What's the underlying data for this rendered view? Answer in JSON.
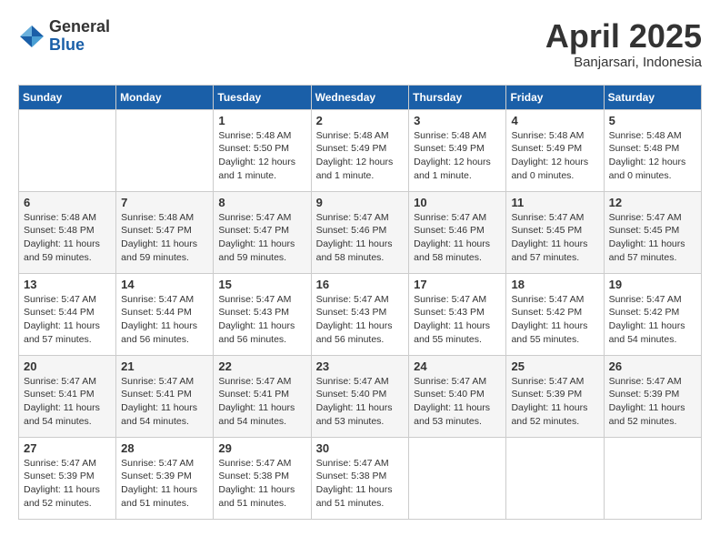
{
  "header": {
    "logo_general": "General",
    "logo_blue": "Blue",
    "title": "April 2025",
    "location": "Banjarsari, Indonesia"
  },
  "days_of_week": [
    "Sunday",
    "Monday",
    "Tuesday",
    "Wednesday",
    "Thursday",
    "Friday",
    "Saturday"
  ],
  "weeks": [
    [
      {
        "day": "",
        "info": ""
      },
      {
        "day": "",
        "info": ""
      },
      {
        "day": "1",
        "info": "Sunrise: 5:48 AM\nSunset: 5:50 PM\nDaylight: 12 hours\nand 1 minute."
      },
      {
        "day": "2",
        "info": "Sunrise: 5:48 AM\nSunset: 5:49 PM\nDaylight: 12 hours\nand 1 minute."
      },
      {
        "day": "3",
        "info": "Sunrise: 5:48 AM\nSunset: 5:49 PM\nDaylight: 12 hours\nand 1 minute."
      },
      {
        "day": "4",
        "info": "Sunrise: 5:48 AM\nSunset: 5:49 PM\nDaylight: 12 hours\nand 0 minutes."
      },
      {
        "day": "5",
        "info": "Sunrise: 5:48 AM\nSunset: 5:48 PM\nDaylight: 12 hours\nand 0 minutes."
      }
    ],
    [
      {
        "day": "6",
        "info": "Sunrise: 5:48 AM\nSunset: 5:48 PM\nDaylight: 11 hours\nand 59 minutes."
      },
      {
        "day": "7",
        "info": "Sunrise: 5:48 AM\nSunset: 5:47 PM\nDaylight: 11 hours\nand 59 minutes."
      },
      {
        "day": "8",
        "info": "Sunrise: 5:47 AM\nSunset: 5:47 PM\nDaylight: 11 hours\nand 59 minutes."
      },
      {
        "day": "9",
        "info": "Sunrise: 5:47 AM\nSunset: 5:46 PM\nDaylight: 11 hours\nand 58 minutes."
      },
      {
        "day": "10",
        "info": "Sunrise: 5:47 AM\nSunset: 5:46 PM\nDaylight: 11 hours\nand 58 minutes."
      },
      {
        "day": "11",
        "info": "Sunrise: 5:47 AM\nSunset: 5:45 PM\nDaylight: 11 hours\nand 57 minutes."
      },
      {
        "day": "12",
        "info": "Sunrise: 5:47 AM\nSunset: 5:45 PM\nDaylight: 11 hours\nand 57 minutes."
      }
    ],
    [
      {
        "day": "13",
        "info": "Sunrise: 5:47 AM\nSunset: 5:44 PM\nDaylight: 11 hours\nand 57 minutes."
      },
      {
        "day": "14",
        "info": "Sunrise: 5:47 AM\nSunset: 5:44 PM\nDaylight: 11 hours\nand 56 minutes."
      },
      {
        "day": "15",
        "info": "Sunrise: 5:47 AM\nSunset: 5:43 PM\nDaylight: 11 hours\nand 56 minutes."
      },
      {
        "day": "16",
        "info": "Sunrise: 5:47 AM\nSunset: 5:43 PM\nDaylight: 11 hours\nand 56 minutes."
      },
      {
        "day": "17",
        "info": "Sunrise: 5:47 AM\nSunset: 5:43 PM\nDaylight: 11 hours\nand 55 minutes."
      },
      {
        "day": "18",
        "info": "Sunrise: 5:47 AM\nSunset: 5:42 PM\nDaylight: 11 hours\nand 55 minutes."
      },
      {
        "day": "19",
        "info": "Sunrise: 5:47 AM\nSunset: 5:42 PM\nDaylight: 11 hours\nand 54 minutes."
      }
    ],
    [
      {
        "day": "20",
        "info": "Sunrise: 5:47 AM\nSunset: 5:41 PM\nDaylight: 11 hours\nand 54 minutes."
      },
      {
        "day": "21",
        "info": "Sunrise: 5:47 AM\nSunset: 5:41 PM\nDaylight: 11 hours\nand 54 minutes."
      },
      {
        "day": "22",
        "info": "Sunrise: 5:47 AM\nSunset: 5:41 PM\nDaylight: 11 hours\nand 54 minutes."
      },
      {
        "day": "23",
        "info": "Sunrise: 5:47 AM\nSunset: 5:40 PM\nDaylight: 11 hours\nand 53 minutes."
      },
      {
        "day": "24",
        "info": "Sunrise: 5:47 AM\nSunset: 5:40 PM\nDaylight: 11 hours\nand 53 minutes."
      },
      {
        "day": "25",
        "info": "Sunrise: 5:47 AM\nSunset: 5:39 PM\nDaylight: 11 hours\nand 52 minutes."
      },
      {
        "day": "26",
        "info": "Sunrise: 5:47 AM\nSunset: 5:39 PM\nDaylight: 11 hours\nand 52 minutes."
      }
    ],
    [
      {
        "day": "27",
        "info": "Sunrise: 5:47 AM\nSunset: 5:39 PM\nDaylight: 11 hours\nand 52 minutes."
      },
      {
        "day": "28",
        "info": "Sunrise: 5:47 AM\nSunset: 5:39 PM\nDaylight: 11 hours\nand 51 minutes."
      },
      {
        "day": "29",
        "info": "Sunrise: 5:47 AM\nSunset: 5:38 PM\nDaylight: 11 hours\nand 51 minutes."
      },
      {
        "day": "30",
        "info": "Sunrise: 5:47 AM\nSunset: 5:38 PM\nDaylight: 11 hours\nand 51 minutes."
      },
      {
        "day": "",
        "info": ""
      },
      {
        "day": "",
        "info": ""
      },
      {
        "day": "",
        "info": ""
      }
    ]
  ]
}
